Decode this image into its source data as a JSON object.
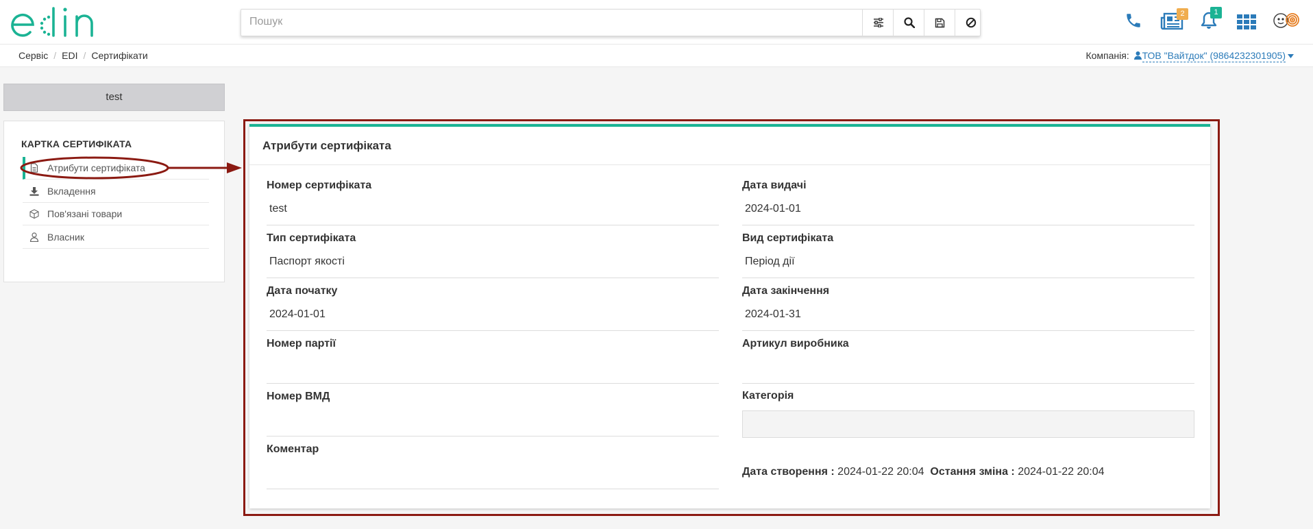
{
  "header": {
    "logo_text": "edin",
    "search": {
      "placeholder": "Пошук",
      "value": ""
    },
    "search_buttons": [
      "filter-icon",
      "search-icon",
      "save-icon",
      "clear-icon"
    ],
    "right_icons": [
      {
        "icon": "phone-icon"
      },
      {
        "icon": "news-icon",
        "badge": "2",
        "badge_color": "#f0ad4e"
      },
      {
        "icon": "bell-icon",
        "badge": "1",
        "badge_color": "#1bb394"
      },
      {
        "icon": "apps-grid-icon"
      },
      {
        "icon": "user-avatar"
      }
    ]
  },
  "breadcrumb": {
    "items": [
      "Сервіс",
      "EDI",
      "Сертифікати"
    ]
  },
  "company": {
    "label": "Компанія:",
    "value": "ТОВ \"Вайтдок\" (9864232301905)"
  },
  "sidebar": {
    "tab_label": "test",
    "title": "КАРТКА СЕРТИФІКАТА",
    "items": [
      {
        "label": "Атрибути сертифіката",
        "icon": "document-icon",
        "active": true
      },
      {
        "label": "Вкладення",
        "icon": "download-icon",
        "active": false
      },
      {
        "label": "Пов'язані товари",
        "icon": "box-icon",
        "active": false
      },
      {
        "label": "Власник",
        "icon": "user-icon",
        "active": false
      }
    ]
  },
  "panel": {
    "title": "Атрибути сертифіката",
    "fields": {
      "cert_number": {
        "label": "Номер сертифіката",
        "value": "test"
      },
      "issue_date": {
        "label": "Дата видачі",
        "value": "2024-01-01"
      },
      "cert_type": {
        "label": "Тип сертифіката",
        "value": "Паспорт якості"
      },
      "cert_kind": {
        "label": "Вид сертифіката",
        "value": "Період дії"
      },
      "start_date": {
        "label": "Дата початку",
        "value": "2024-01-01"
      },
      "end_date": {
        "label": "Дата закінчення",
        "value": "2024-01-31"
      },
      "batch_number": {
        "label": "Номер партії",
        "value": ""
      },
      "manufacturer_sku": {
        "label": "Артикул виробника",
        "value": ""
      },
      "vmd_number": {
        "label": "Номер ВМД",
        "value": ""
      },
      "category": {
        "label": "Категорія",
        "value": ""
      },
      "comment": {
        "label": "Коментар",
        "value": ""
      }
    },
    "created_label": "Дата створення :",
    "created_value": "2024-01-22 20:04",
    "modified_label": "Остання зміна :",
    "modified_value": "2024-01-22 20:04"
  },
  "colors": {
    "accent": "#1bb394",
    "link": "#2b7bb9",
    "annotation": "#8b1a12",
    "badge_news": "#f0ad4e",
    "badge_bell": "#1bb394"
  }
}
